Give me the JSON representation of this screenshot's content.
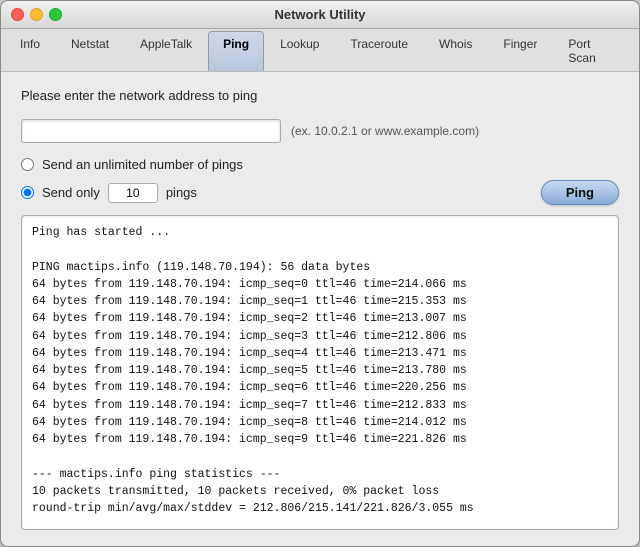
{
  "window": {
    "title": "Network Utility"
  },
  "tabs": [
    {
      "id": "info",
      "label": "Info",
      "active": false
    },
    {
      "id": "netstat",
      "label": "Netstat",
      "active": false
    },
    {
      "id": "appletalk",
      "label": "AppleTalk",
      "active": false
    },
    {
      "id": "ping",
      "label": "Ping",
      "active": true
    },
    {
      "id": "lookup",
      "label": "Lookup",
      "active": false
    },
    {
      "id": "traceroute",
      "label": "Traceroute",
      "active": false
    },
    {
      "id": "whois",
      "label": "Whois",
      "active": false
    },
    {
      "id": "finger",
      "label": "Finger",
      "active": false
    },
    {
      "id": "portscan",
      "label": "Port Scan",
      "active": false
    }
  ],
  "ping": {
    "section_label": "Please enter the network address to ping",
    "address_placeholder": "",
    "address_value": "",
    "hint": "(ex. 10.0.2.1 or www.example.com)",
    "radio_unlimited_label": "Send an unlimited number of pings",
    "radio_only_label": "Send only",
    "ping_count": "10",
    "pings_suffix": "pings",
    "ping_button_label": "Ping",
    "output": "Ping has started ...\n\nPING mactips.info (119.148.70.194): 56 data bytes\n64 bytes from 119.148.70.194: icmp_seq=0 ttl=46 time=214.066 ms\n64 bytes from 119.148.70.194: icmp_seq=1 ttl=46 time=215.353 ms\n64 bytes from 119.148.70.194: icmp_seq=2 ttl=46 time=213.007 ms\n64 bytes from 119.148.70.194: icmp_seq=3 ttl=46 time=212.806 ms\n64 bytes from 119.148.70.194: icmp_seq=4 ttl=46 time=213.471 ms\n64 bytes from 119.148.70.194: icmp_seq=5 ttl=46 time=213.780 ms\n64 bytes from 119.148.70.194: icmp_seq=6 ttl=46 time=220.256 ms\n64 bytes from 119.148.70.194: icmp_seq=7 ttl=46 time=212.833 ms\n64 bytes from 119.148.70.194: icmp_seq=8 ttl=46 time=214.012 ms\n64 bytes from 119.148.70.194: icmp_seq=9 ttl=46 time=221.826 ms\n\n--- mactips.info ping statistics ---\n10 packets transmitted, 10 packets received, 0% packet loss\nround-trip min/avg/max/stddev = 212.806/215.141/221.826/3.055 ms"
  }
}
